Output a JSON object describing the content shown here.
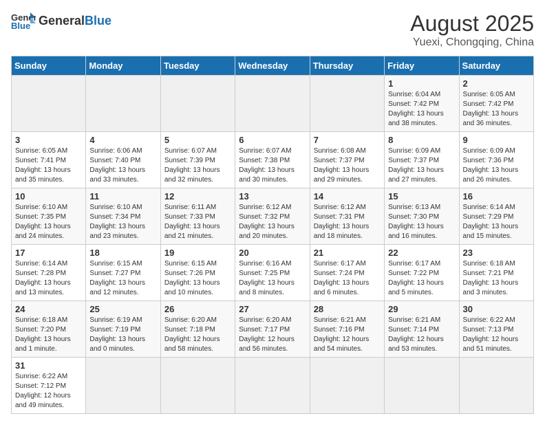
{
  "logo": {
    "general": "General",
    "blue": "Blue"
  },
  "title": "August 2025",
  "subtitle": "Yuexi, Chongqing, China",
  "headers": [
    "Sunday",
    "Monday",
    "Tuesday",
    "Wednesday",
    "Thursday",
    "Friday",
    "Saturday"
  ],
  "weeks": [
    [
      {
        "day": "",
        "info": ""
      },
      {
        "day": "",
        "info": ""
      },
      {
        "day": "",
        "info": ""
      },
      {
        "day": "",
        "info": ""
      },
      {
        "day": "",
        "info": ""
      },
      {
        "day": "1",
        "info": "Sunrise: 6:04 AM\nSunset: 7:42 PM\nDaylight: 13 hours and 38 minutes."
      },
      {
        "day": "2",
        "info": "Sunrise: 6:05 AM\nSunset: 7:42 PM\nDaylight: 13 hours and 36 minutes."
      }
    ],
    [
      {
        "day": "3",
        "info": "Sunrise: 6:05 AM\nSunset: 7:41 PM\nDaylight: 13 hours and 35 minutes."
      },
      {
        "day": "4",
        "info": "Sunrise: 6:06 AM\nSunset: 7:40 PM\nDaylight: 13 hours and 33 minutes."
      },
      {
        "day": "5",
        "info": "Sunrise: 6:07 AM\nSunset: 7:39 PM\nDaylight: 13 hours and 32 minutes."
      },
      {
        "day": "6",
        "info": "Sunrise: 6:07 AM\nSunset: 7:38 PM\nDaylight: 13 hours and 30 minutes."
      },
      {
        "day": "7",
        "info": "Sunrise: 6:08 AM\nSunset: 7:37 PM\nDaylight: 13 hours and 29 minutes."
      },
      {
        "day": "8",
        "info": "Sunrise: 6:09 AM\nSunset: 7:37 PM\nDaylight: 13 hours and 27 minutes."
      },
      {
        "day": "9",
        "info": "Sunrise: 6:09 AM\nSunset: 7:36 PM\nDaylight: 13 hours and 26 minutes."
      }
    ],
    [
      {
        "day": "10",
        "info": "Sunrise: 6:10 AM\nSunset: 7:35 PM\nDaylight: 13 hours and 24 minutes."
      },
      {
        "day": "11",
        "info": "Sunrise: 6:10 AM\nSunset: 7:34 PM\nDaylight: 13 hours and 23 minutes."
      },
      {
        "day": "12",
        "info": "Sunrise: 6:11 AM\nSunset: 7:33 PM\nDaylight: 13 hours and 21 minutes."
      },
      {
        "day": "13",
        "info": "Sunrise: 6:12 AM\nSunset: 7:32 PM\nDaylight: 13 hours and 20 minutes."
      },
      {
        "day": "14",
        "info": "Sunrise: 6:12 AM\nSunset: 7:31 PM\nDaylight: 13 hours and 18 minutes."
      },
      {
        "day": "15",
        "info": "Sunrise: 6:13 AM\nSunset: 7:30 PM\nDaylight: 13 hours and 16 minutes."
      },
      {
        "day": "16",
        "info": "Sunrise: 6:14 AM\nSunset: 7:29 PM\nDaylight: 13 hours and 15 minutes."
      }
    ],
    [
      {
        "day": "17",
        "info": "Sunrise: 6:14 AM\nSunset: 7:28 PM\nDaylight: 13 hours and 13 minutes."
      },
      {
        "day": "18",
        "info": "Sunrise: 6:15 AM\nSunset: 7:27 PM\nDaylight: 13 hours and 12 minutes."
      },
      {
        "day": "19",
        "info": "Sunrise: 6:15 AM\nSunset: 7:26 PM\nDaylight: 13 hours and 10 minutes."
      },
      {
        "day": "20",
        "info": "Sunrise: 6:16 AM\nSunset: 7:25 PM\nDaylight: 13 hours and 8 minutes."
      },
      {
        "day": "21",
        "info": "Sunrise: 6:17 AM\nSunset: 7:24 PM\nDaylight: 13 hours and 6 minutes."
      },
      {
        "day": "22",
        "info": "Sunrise: 6:17 AM\nSunset: 7:22 PM\nDaylight: 13 hours and 5 minutes."
      },
      {
        "day": "23",
        "info": "Sunrise: 6:18 AM\nSunset: 7:21 PM\nDaylight: 13 hours and 3 minutes."
      }
    ],
    [
      {
        "day": "24",
        "info": "Sunrise: 6:18 AM\nSunset: 7:20 PM\nDaylight: 13 hours and 1 minute."
      },
      {
        "day": "25",
        "info": "Sunrise: 6:19 AM\nSunset: 7:19 PM\nDaylight: 13 hours and 0 minutes."
      },
      {
        "day": "26",
        "info": "Sunrise: 6:20 AM\nSunset: 7:18 PM\nDaylight: 12 hours and 58 minutes."
      },
      {
        "day": "27",
        "info": "Sunrise: 6:20 AM\nSunset: 7:17 PM\nDaylight: 12 hours and 56 minutes."
      },
      {
        "day": "28",
        "info": "Sunrise: 6:21 AM\nSunset: 7:16 PM\nDaylight: 12 hours and 54 minutes."
      },
      {
        "day": "29",
        "info": "Sunrise: 6:21 AM\nSunset: 7:14 PM\nDaylight: 12 hours and 53 minutes."
      },
      {
        "day": "30",
        "info": "Sunrise: 6:22 AM\nSunset: 7:13 PM\nDaylight: 12 hours and 51 minutes."
      }
    ],
    [
      {
        "day": "31",
        "info": "Sunrise: 6:22 AM\nSunset: 7:12 PM\nDaylight: 12 hours and 49 minutes."
      },
      {
        "day": "",
        "info": ""
      },
      {
        "day": "",
        "info": ""
      },
      {
        "day": "",
        "info": ""
      },
      {
        "day": "",
        "info": ""
      },
      {
        "day": "",
        "info": ""
      },
      {
        "day": "",
        "info": ""
      }
    ]
  ]
}
